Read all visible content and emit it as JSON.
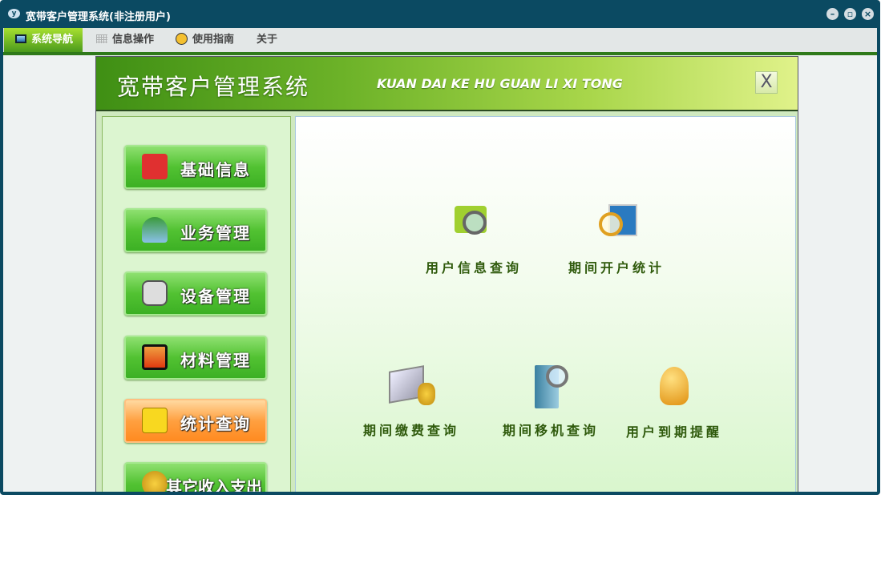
{
  "window": {
    "title": "宽带客户管理系统(非注册用户)",
    "logo_text": "y"
  },
  "menu": [
    {
      "label": "系统导航"
    },
    {
      "label": "信息操作"
    },
    {
      "label": "使用指南"
    },
    {
      "label": "关于"
    }
  ],
  "header": {
    "title_cn": "宽带客户管理系统",
    "title_en": "KUAN DAI KE HU GUAN LI XI TONG",
    "close": "X"
  },
  "sidebar": [
    {
      "label": "基础信息"
    },
    {
      "label": "业务管理"
    },
    {
      "label": "设备管理"
    },
    {
      "label": "材料管理"
    },
    {
      "label": "统计查询",
      "active": true
    },
    {
      "label": "其它收入支出"
    }
  ],
  "main": [
    {
      "label": "用户信息查询"
    },
    {
      "label": "期间开户统计"
    },
    {
      "label": "期间缴费查询"
    },
    {
      "label": "期间移机查询"
    },
    {
      "label": "用户到期提醒"
    }
  ]
}
